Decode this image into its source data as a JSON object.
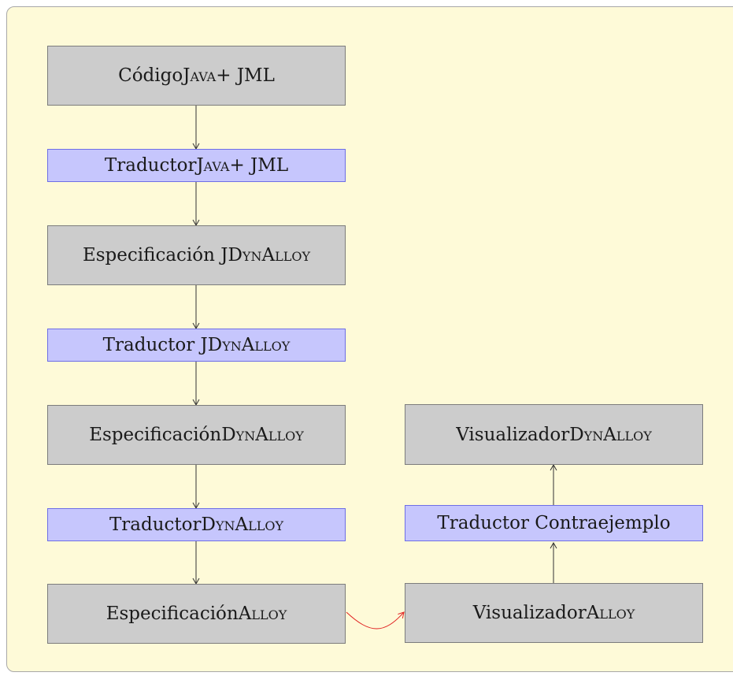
{
  "nodes": {
    "java_code": {
      "prefix": "Código ",
      "sc": "Java",
      "suffix": " + JML"
    },
    "java_translator": {
      "prefix": "Traductor ",
      "sc": "Java",
      "suffix": " + JML"
    },
    "jdyn_spec": {
      "prefix": "Especificación JD",
      "sc": "ynAlloy",
      "suffix": ""
    },
    "jdyn_translator": {
      "prefix": "Traductor JD",
      "sc": "ynAlloy",
      "suffix": ""
    },
    "dyn_spec": {
      "prefix": "Especificación ",
      "sc": "DynAlloy",
      "suffix": ""
    },
    "dyn_translator": {
      "prefix": "Traductor ",
      "sc": "DynAlloy",
      "suffix": ""
    },
    "alloy_spec": {
      "prefix": "Especificación ",
      "sc": "Alloy",
      "suffix": ""
    },
    "alloy_viz": {
      "prefix": "Visualizador ",
      "sc": "Alloy",
      "suffix": ""
    },
    "counterexample_translator": {
      "prefix": "Traductor Contraejemplo",
      "sc": "",
      "suffix": ""
    },
    "dyn_viz": {
      "prefix": "Visualizador ",
      "sc": "DynAlloy",
      "suffix": ""
    }
  },
  "colors": {
    "process_fill": "#cccccc",
    "translator_fill": "#c6c6fd",
    "panel_bg": "#fefad8",
    "highlight_arrow": "#e02020"
  }
}
